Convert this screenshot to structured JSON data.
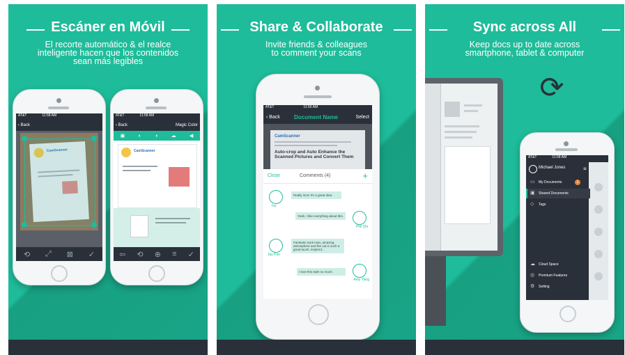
{
  "panel1": {
    "title": "Escáner en Móvil",
    "subtitle_lines": [
      "El recorte automático & el realce",
      "inteligente hacen que los contenidos",
      "sean más legibles"
    ],
    "left_phone": {
      "status_carrier": "AT&T",
      "status_time": "11:58 AM",
      "back_label": "Back",
      "doc_heading": "CamScanner"
    },
    "right_phone": {
      "status_carrier": "AT&T",
      "status_time": "11:58 AM",
      "back_label": "Back",
      "mode_label": "Magic Color",
      "doc_heading": "CamScanner"
    }
  },
  "panel2": {
    "title": "Share & Collaborate",
    "subtitle_lines": [
      "Invite friends & colleagues",
      "to comment your scans"
    ],
    "phone": {
      "status_carrier": "AT&T",
      "status_time": "11:56 AM",
      "back_label": "Back",
      "nav_title": "Document Name",
      "select_label": "Select",
      "doc_heading": "CamScanner",
      "doc_headline": "Auto-crop and Auto Enhance the Scanned Pictures and Convert Them",
      "close_label": "Close",
      "comments_label": "Comments",
      "comments_count": "(4)",
      "add_symbol": "+",
      "comments": [
        {
          "name": "Ivy",
          "text": "Really nice! It's a great idea.",
          "side": "left"
        },
        {
          "name": "Phil Shi",
          "text": "Yeah, I like everything about this.",
          "side": "right"
        },
        {
          "name": "Jay Pan",
          "text": "Fantastic work man, amazing atmosphere and the cat is such a great touch, inspired...",
          "side": "left"
        },
        {
          "name": "Amy Yang",
          "text": "I love this style so much.",
          "side": "right"
        }
      ]
    }
  },
  "panel3": {
    "title": "Sync across All",
    "subtitle_lines": [
      "Keep docs up to date across",
      "smartphone, tablet & computer"
    ],
    "phone": {
      "status_carrier": "AT&T",
      "status_time": "11:58 AM",
      "user_name": "Michael Jones",
      "menu": [
        {
          "label": "My Documents",
          "badge": "1"
        },
        {
          "label": "Shared Documents",
          "badge": ""
        },
        {
          "label": "Tags",
          "badge": ""
        }
      ],
      "footer_menu": [
        "Cloud Space",
        "Premium Features",
        "Setting"
      ]
    }
  },
  "colors": {
    "teal": "#1ebc9a",
    "dark": "#2a3039",
    "accent": "#1ebc9a"
  }
}
